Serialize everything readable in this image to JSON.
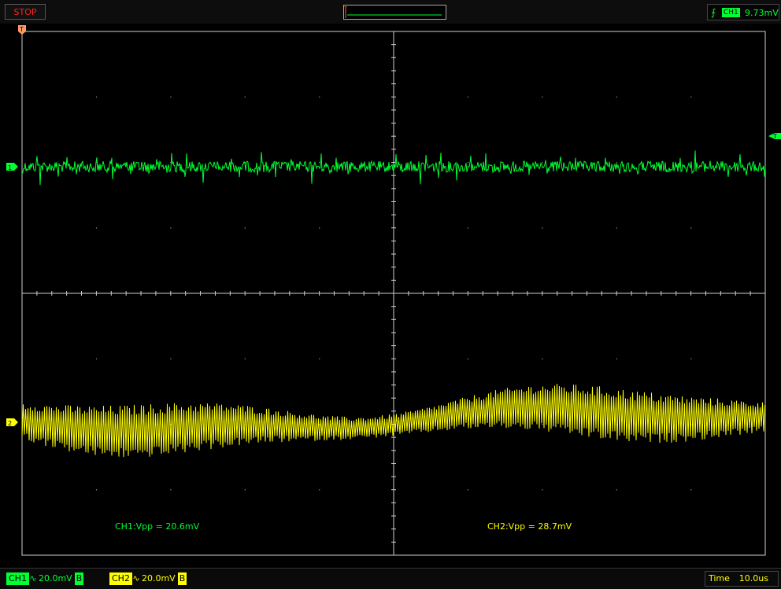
{
  "topbar": {
    "run_state": "STOP",
    "trigger": {
      "edge_icon": "rising-edge-icon",
      "source": "CH1",
      "level": "9.73mV"
    }
  },
  "markers": {
    "trigger_pos": "T",
    "trigger_level": "T",
    "ch1": "1",
    "ch2": "2"
  },
  "measurements": {
    "ch1": "CH1:Vpp = 20.6mV",
    "ch2": "CH2:Vpp = 28.7mV"
  },
  "statusbar": {
    "ch1": {
      "label": "CH1",
      "coupling_icon": "ac-coupling-icon",
      "coupling": "∿",
      "volts_div": "20.0mV",
      "bw": "B"
    },
    "ch2": {
      "label": "CH2",
      "coupling_icon": "ac-coupling-icon",
      "coupling": "∿",
      "volts_div": "20.0mV",
      "bw": "B"
    },
    "time_label": "Time",
    "time_div": "10.0us"
  },
  "colors": {
    "ch1": "#00ff33",
    "ch2": "#ffff00",
    "grid": "#cfcfcf",
    "background": "#000000",
    "marker": "#ff9966"
  }
}
